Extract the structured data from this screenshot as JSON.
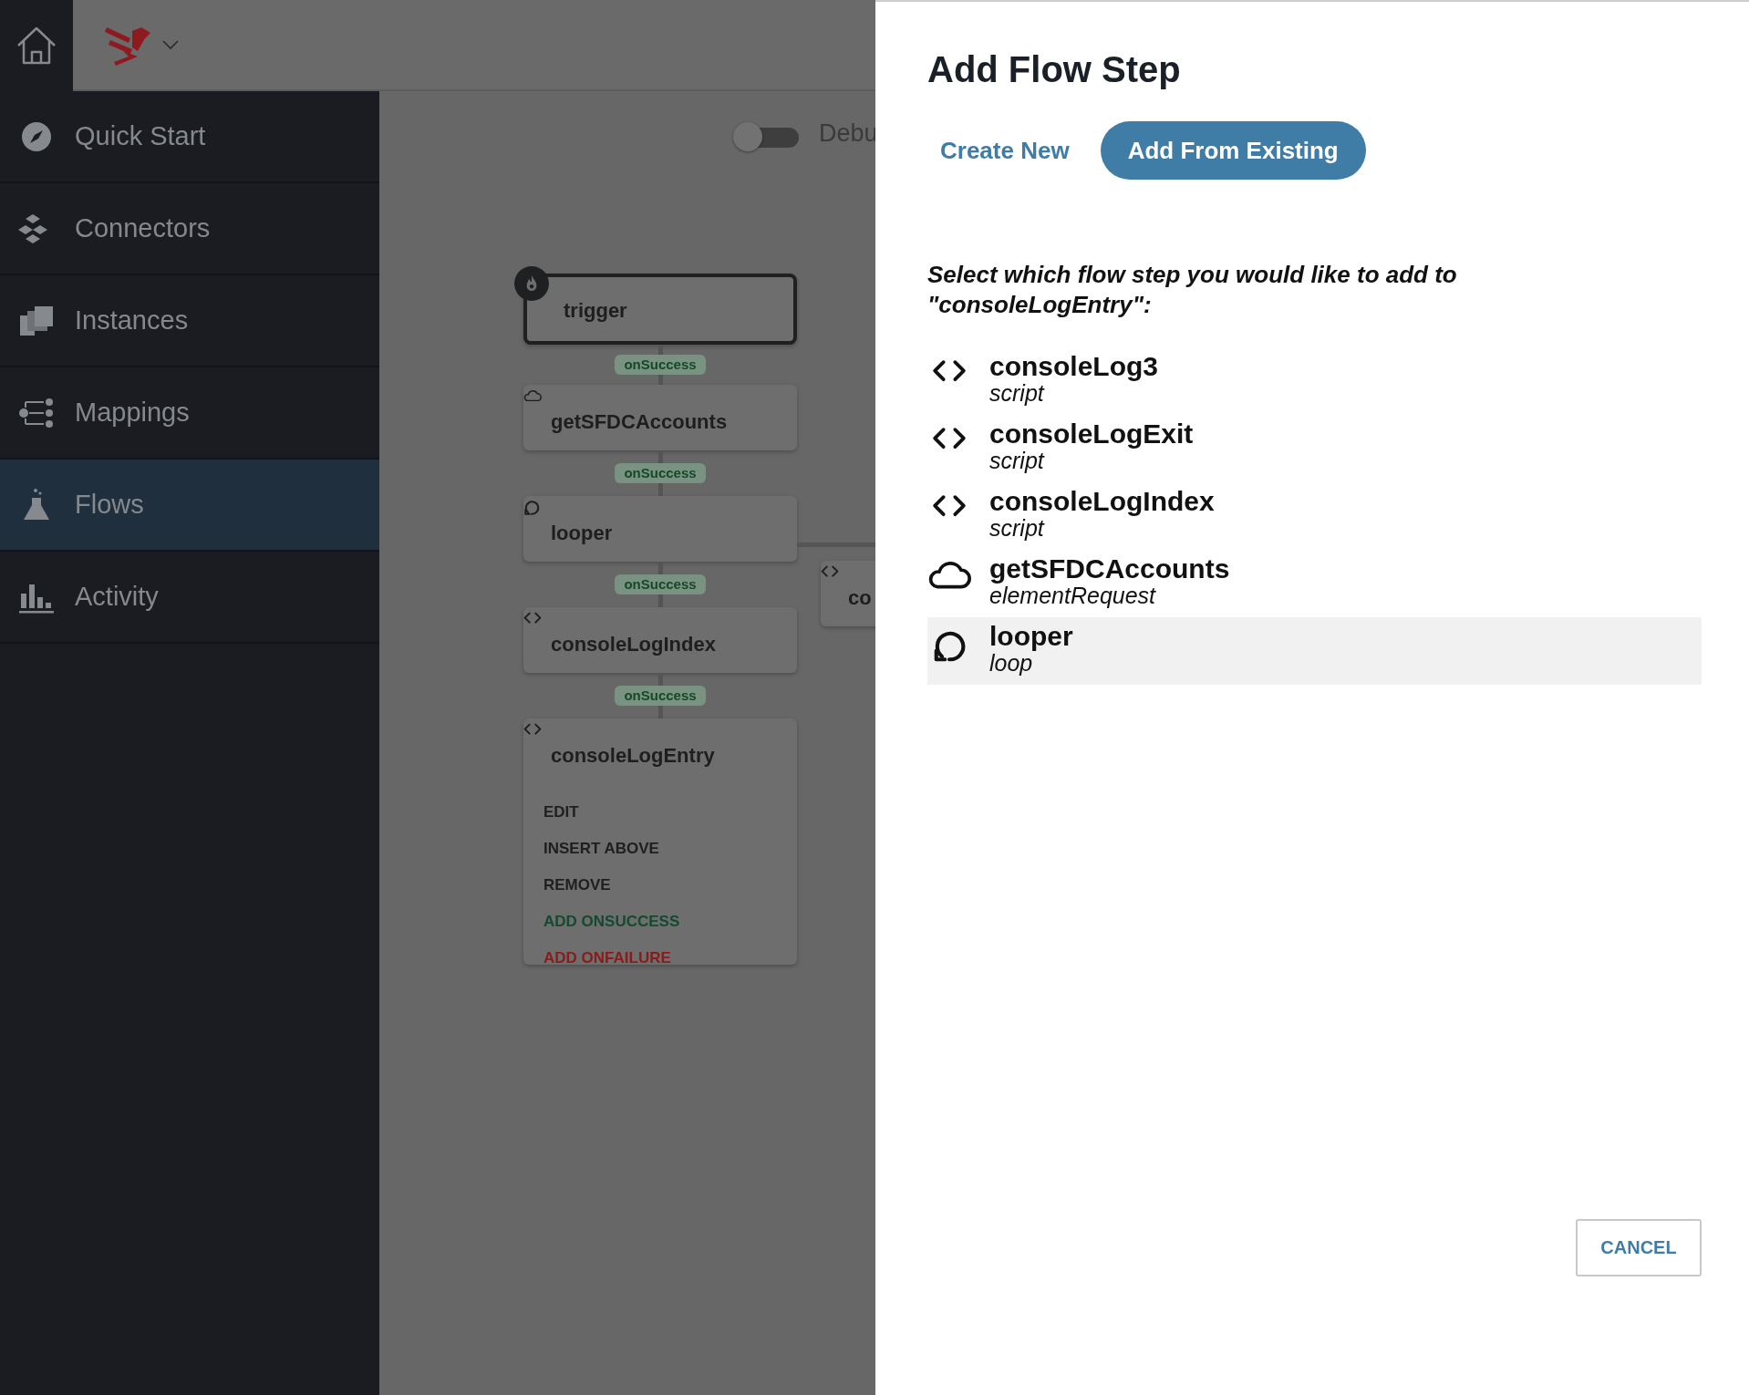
{
  "sidebar": {
    "items": [
      {
        "label": "Quick Start",
        "selected": false
      },
      {
        "label": "Connectors",
        "selected": false
      },
      {
        "label": "Instances",
        "selected": false
      },
      {
        "label": "Mappings",
        "selected": false
      },
      {
        "label": "Flows",
        "selected": true
      },
      {
        "label": "Activity",
        "selected": false
      }
    ]
  },
  "canvas": {
    "debug_toggle": {
      "label": "Debu",
      "on": false
    },
    "nodes": [
      {
        "name": "trigger",
        "kind": "trigger"
      },
      {
        "name": "getSFDCAccounts",
        "kind": "cloud",
        "link": "onSuccess"
      },
      {
        "name": "looper",
        "kind": "loop",
        "link": "onSuccess"
      },
      {
        "name": "consoleLogIndex",
        "kind": "script",
        "link": "onSuccess"
      },
      {
        "name": "consoleLogEntry",
        "kind": "script",
        "link": "onSuccess",
        "menu": [
          {
            "label": "EDIT",
            "kind": "normal"
          },
          {
            "label": "INSERT ABOVE",
            "kind": "normal"
          },
          {
            "label": "REMOVE",
            "kind": "normal"
          },
          {
            "label": "ADD ONSUCCESS",
            "kind": "success"
          },
          {
            "label": "ADD ONFAILURE",
            "kind": "failure"
          }
        ]
      }
    ],
    "side_node": {
      "name": "co",
      "kind": "script"
    }
  },
  "dialog": {
    "title": "Add Flow Step",
    "tabs": [
      {
        "label": "Create New",
        "selected": false
      },
      {
        "label": "Add From Existing",
        "selected": true
      }
    ],
    "prompt": "Select which flow step you would like to add to \"consoleLogEntry\":",
    "options": [
      {
        "name": "consoleLog3",
        "type": "script",
        "kind": "script",
        "selected": false
      },
      {
        "name": "consoleLogExit",
        "type": "script",
        "kind": "script",
        "selected": false
      },
      {
        "name": "consoleLogIndex",
        "type": "script",
        "kind": "script",
        "selected": false
      },
      {
        "name": "getSFDCAccounts",
        "type": "elementRequest",
        "kind": "cloud",
        "selected": false
      },
      {
        "name": "looper",
        "type": "loop",
        "kind": "loop",
        "selected": true
      }
    ],
    "cancel": "CANCEL"
  }
}
